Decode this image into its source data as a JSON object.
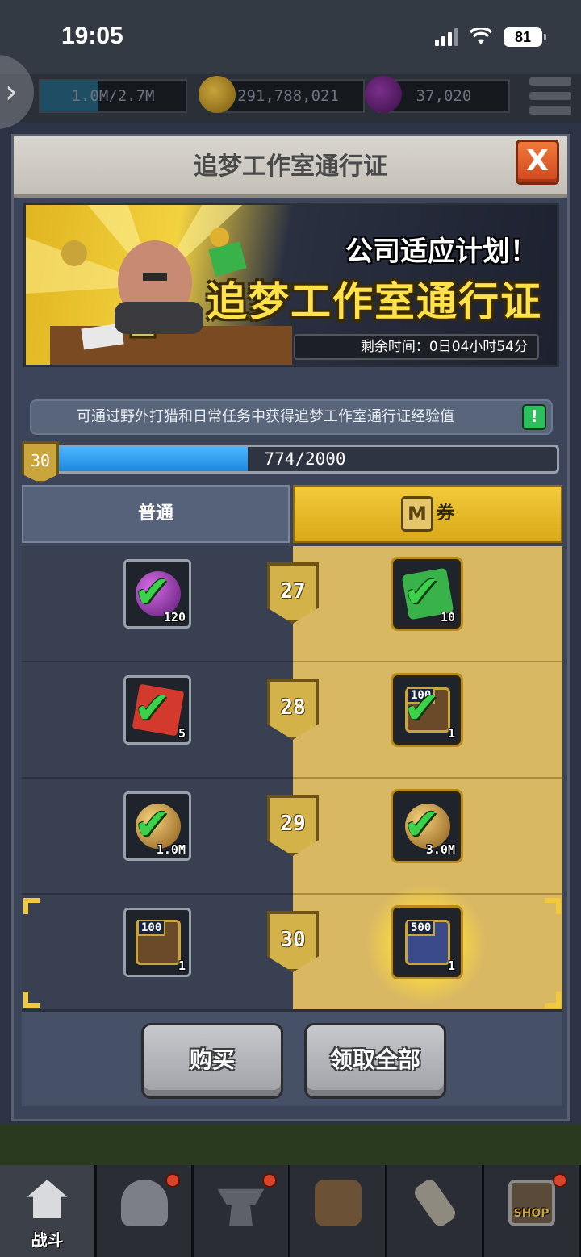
{
  "status_bar": {
    "time": "19:05",
    "battery": "81"
  },
  "resources": {
    "exp": "1.0M/2.7M",
    "gold": "291,788,021",
    "gems": "37,020"
  },
  "dialog": {
    "title": "追梦工作室通行证",
    "close_label": "X",
    "banner": {
      "subtitle": "公司适应计划！",
      "title": "追梦工作室通行证",
      "timer": "剩余时间：0日04小时54分"
    },
    "info": "可通过野外打猎和日常任务中获得追梦工作室通行证经验值",
    "info_icon": "!",
    "progress": {
      "level": "30",
      "text": "774/2000",
      "fraction": 0.387
    },
    "tabs": {
      "normal": "普通",
      "premium_icon": "M",
      "premium": "券"
    },
    "rows": [
      {
        "level": "27",
        "left": {
          "qty": "120",
          "item": "purple-orb"
        },
        "right": {
          "qty": "10",
          "item": "green-gem"
        }
      },
      {
        "level": "28",
        "left": {
          "qty": "5",
          "item": "red-card"
        },
        "right": {
          "qty": "1",
          "item": "chest-100",
          "chest_label": "100"
        }
      },
      {
        "level": "29",
        "left": {
          "qty": "1.0M",
          "item": "gold-orb"
        },
        "right": {
          "qty": "3.0M",
          "item": "gold-orb"
        }
      },
      {
        "level": "30",
        "left": {
          "qty": "1",
          "item": "chest-100",
          "chest_label": "100"
        },
        "right": {
          "qty": "1",
          "item": "chest-500",
          "chest_label": "500"
        }
      }
    ],
    "buttons": {
      "buy": "购买",
      "claim_all": "领取全部"
    }
  },
  "bottom_nav": {
    "battle_label": "战斗",
    "shop_label": "SHOP"
  },
  "colors": {
    "premium_gold": "#d9b864",
    "progress_blue": "#1e88e0",
    "check_green": "#3bd14a"
  }
}
